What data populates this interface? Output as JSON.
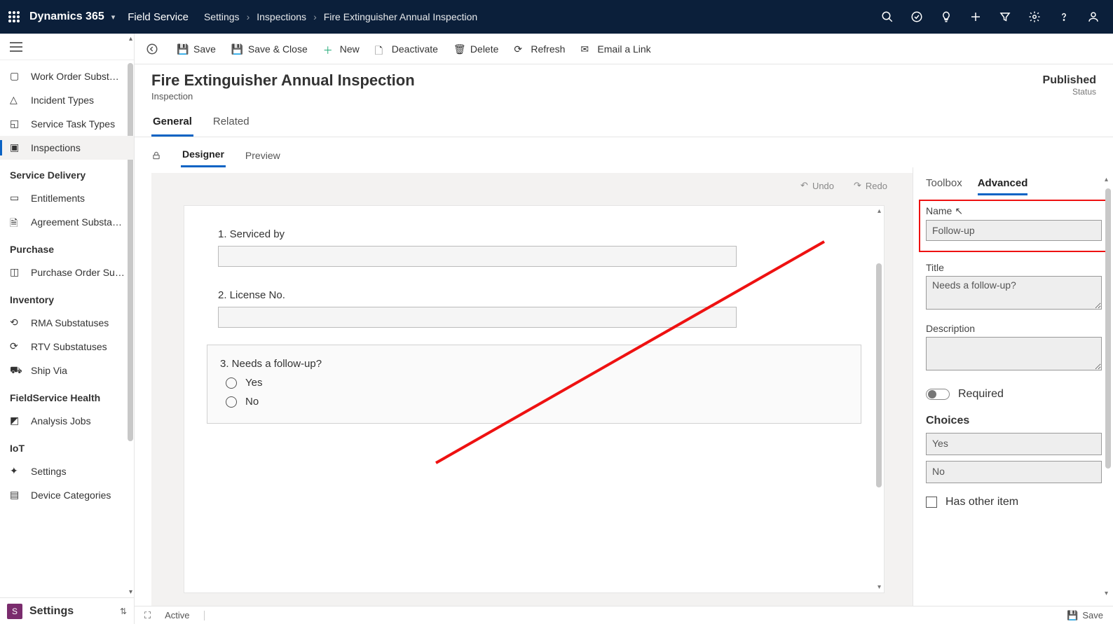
{
  "brand": "Dynamics 365",
  "app": "Field Service",
  "breadcrumbs": [
    "Settings",
    "Inspections",
    "Fire Extinguisher Annual Inspection"
  ],
  "topIcons": [
    "search",
    "task-check",
    "lightbulb",
    "plus",
    "filter-funnel",
    "gear",
    "help",
    "user"
  ],
  "sidebar": {
    "items1": [
      {
        "label": "Work Order Subst…"
      },
      {
        "label": "Incident Types"
      },
      {
        "label": "Service Task Types"
      },
      {
        "label": "Inspections",
        "active": true
      }
    ],
    "group2": "Service Delivery",
    "items2": [
      {
        "label": "Entitlements"
      },
      {
        "label": "Agreement Substa…"
      }
    ],
    "group3": "Purchase",
    "items3": [
      {
        "label": "Purchase Order Su…"
      }
    ],
    "group4": "Inventory",
    "items4": [
      {
        "label": "RMA Substatuses"
      },
      {
        "label": "RTV Substatuses"
      },
      {
        "label": "Ship Via"
      }
    ],
    "group5": "FieldService Health",
    "items5": [
      {
        "label": "Analysis Jobs"
      }
    ],
    "group6": "IoT",
    "items6": [
      {
        "label": "Settings"
      },
      {
        "label": "Device Categories"
      }
    ],
    "switcher": "Settings"
  },
  "commands": {
    "save": "Save",
    "saveclose": "Save & Close",
    "new": "New",
    "deactivate": "Deactivate",
    "delete": "Delete",
    "refresh": "Refresh",
    "email": "Email a Link"
  },
  "record": {
    "title": "Fire Extinguisher Annual Inspection",
    "subtitle": "Inspection",
    "statusValue": "Published",
    "statusLabel": "Status"
  },
  "tabs": {
    "general": "General",
    "related": "Related"
  },
  "subtabs": {
    "designer": "Designer",
    "preview": "Preview"
  },
  "undo": "Undo",
  "redo": "Redo",
  "questions": {
    "q1": "1. Serviced by",
    "q2": "2. License No.",
    "q3": "3. Needs a follow-up?",
    "opt1": "Yes",
    "opt2": "No"
  },
  "panel": {
    "tab1": "Toolbox",
    "tab2": "Advanced",
    "nameLabel": "Name",
    "nameValue": "Follow-up",
    "titleLabel": "Title",
    "titleValue": "Needs a follow-up?",
    "descLabel": "Description",
    "descValue": "",
    "required": "Required",
    "choices": "Choices",
    "c1": "Yes",
    "c2": "No",
    "hasOther": "Has other item"
  },
  "footer": {
    "active": "Active",
    "save": "Save"
  }
}
